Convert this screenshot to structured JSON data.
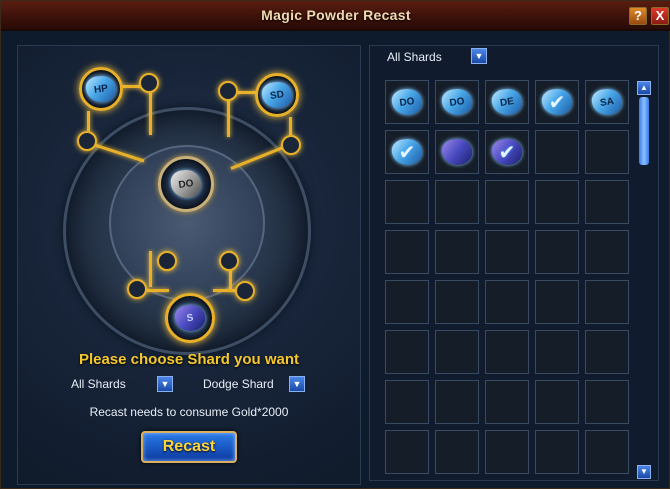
{
  "window": {
    "title": "Magic Powder Recast",
    "help_label": "?",
    "close_label": "X"
  },
  "wheel": {
    "center_gem": "DO",
    "top_left_gem": "HP",
    "top_right_gem": "SD",
    "bottom_gem": "S"
  },
  "prompt": "Please choose Shard you want",
  "filters": {
    "category": "All Shards",
    "shard": "Dodge Shard"
  },
  "cost_text": "Recast needs to consume Gold*2000",
  "recast_label": "Recast",
  "inventory": {
    "filter": "All Shards",
    "items": [
      {
        "label": "DO",
        "style": "blue",
        "checked": false
      },
      {
        "label": "DO",
        "style": "blue",
        "checked": false
      },
      {
        "label": "DE",
        "style": "blue",
        "checked": false
      },
      {
        "label": "",
        "style": "blue",
        "checked": true
      },
      {
        "label": "SA",
        "style": "blue",
        "checked": false
      },
      {
        "label": "",
        "style": "blue",
        "checked": true
      },
      {
        "label": "",
        "style": "dark",
        "checked": false
      },
      {
        "label": "",
        "style": "dark",
        "checked": true
      }
    ],
    "total_slots": 40
  },
  "colors": {
    "gold": "#e8b028",
    "prompt_yellow": "#f5c830",
    "title_bar": "#3a110a"
  }
}
